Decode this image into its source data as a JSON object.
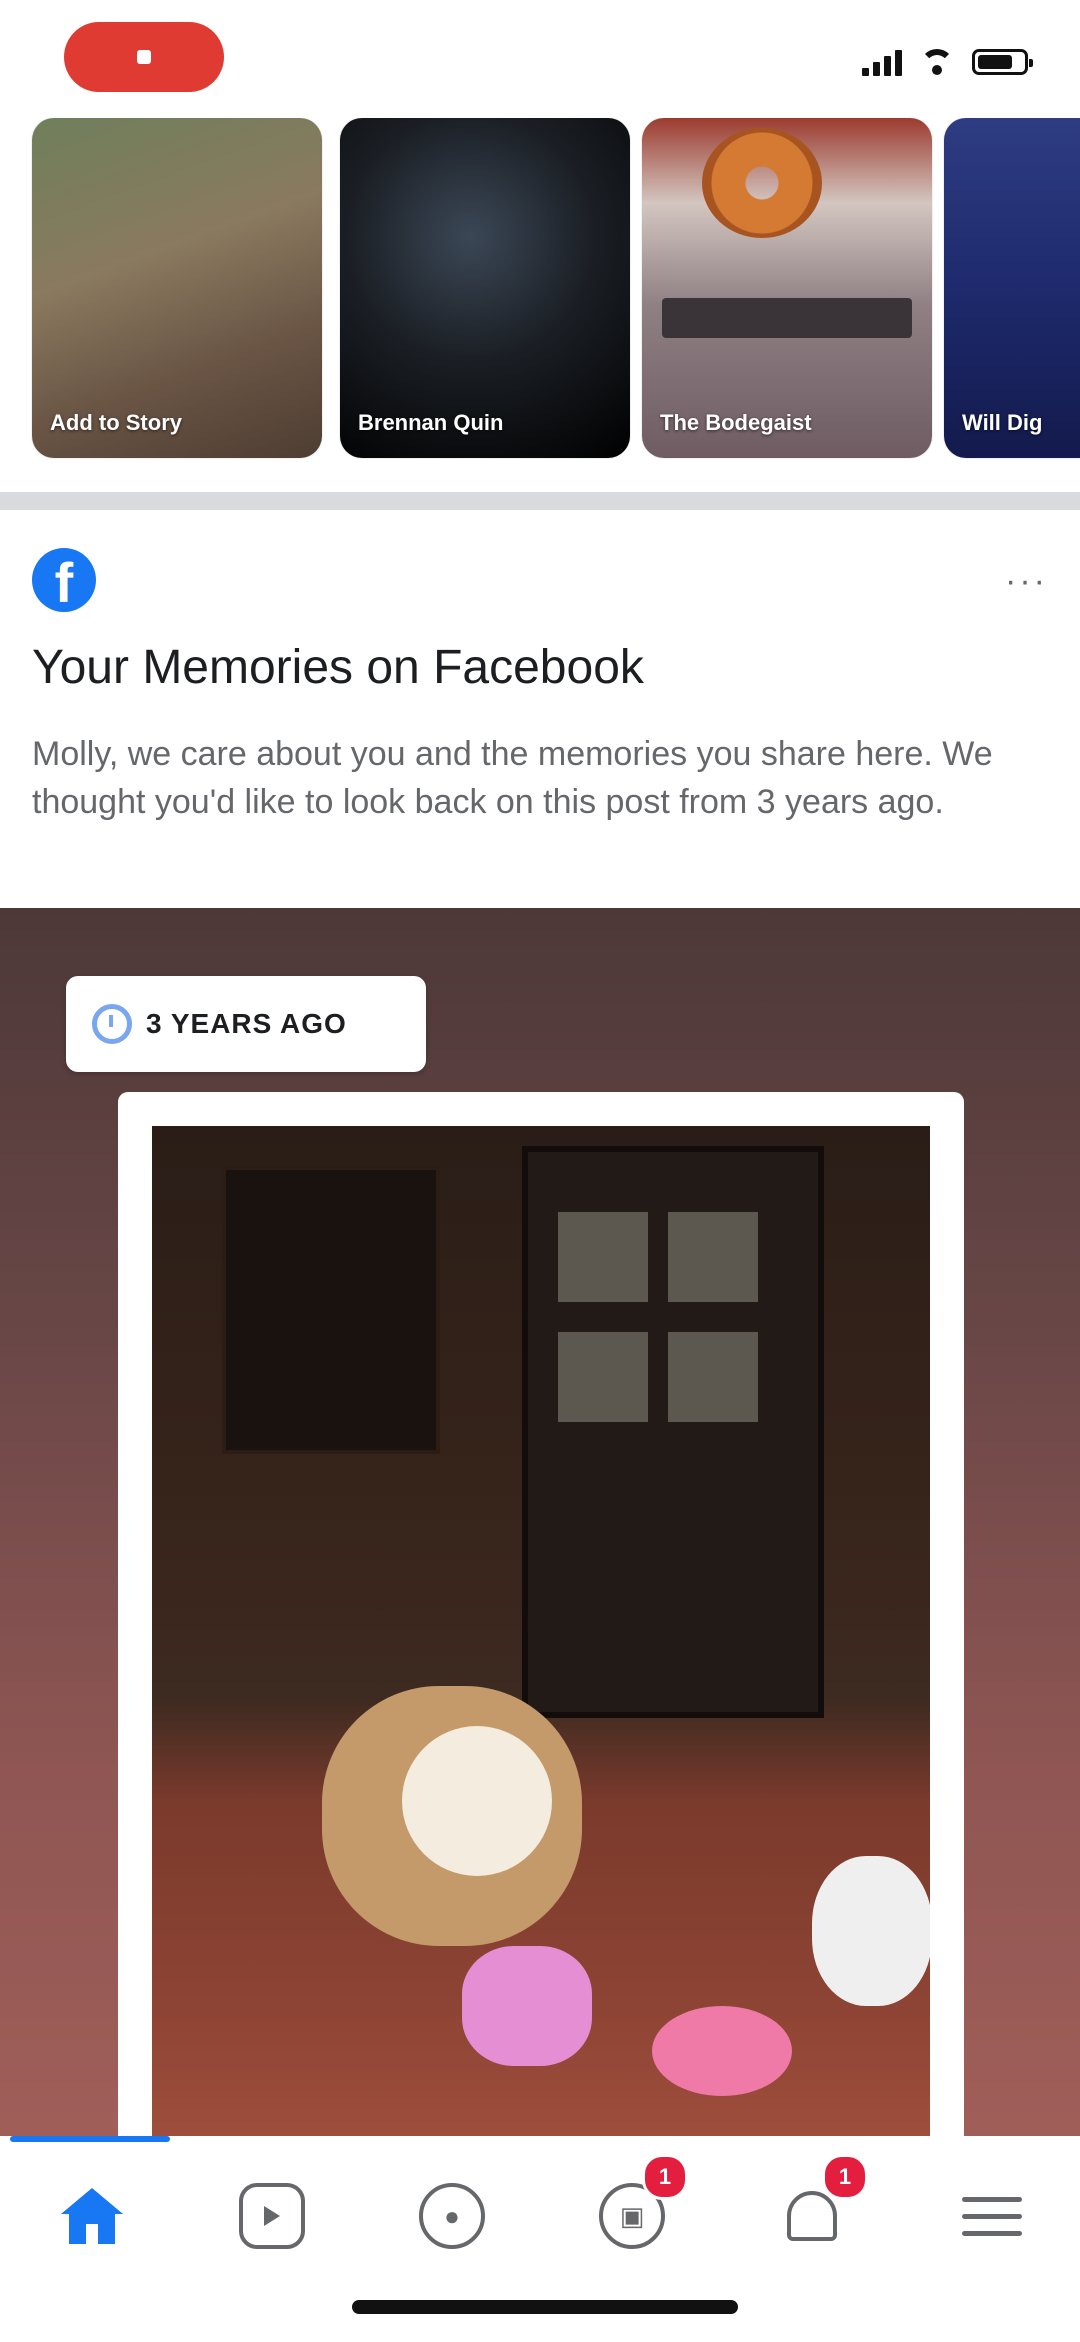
{
  "status_bar": {
    "recording_color": "#e03b33"
  },
  "stories": [
    {
      "name": "Add to Story"
    },
    {
      "name": "Brennan Quin"
    },
    {
      "name": "The Bodegaist"
    },
    {
      "name": "Will Dig"
    }
  ],
  "memory": {
    "title": "Your Memories on Facebook",
    "body": "Molly, we care about you and the memories you share here. We thought you'd like to look back on this post from 3 years ago.",
    "more_label": "···",
    "badge_text": "3 YEARS AGO"
  },
  "tab_bar": {
    "tabs": [
      {
        "name": "home",
        "icon": "home-icon",
        "active": true
      },
      {
        "name": "watch",
        "icon": "video-icon"
      },
      {
        "name": "groups",
        "icon": "groups-icon"
      },
      {
        "name": "marketplace",
        "icon": "marketplace-icon",
        "badge": "1"
      },
      {
        "name": "notifications",
        "icon": "bell-icon",
        "badge": "1"
      },
      {
        "name": "menu",
        "icon": "menu-icon"
      }
    ],
    "accent_color": "#1877f2",
    "badge_color": "#e41e3f"
  }
}
